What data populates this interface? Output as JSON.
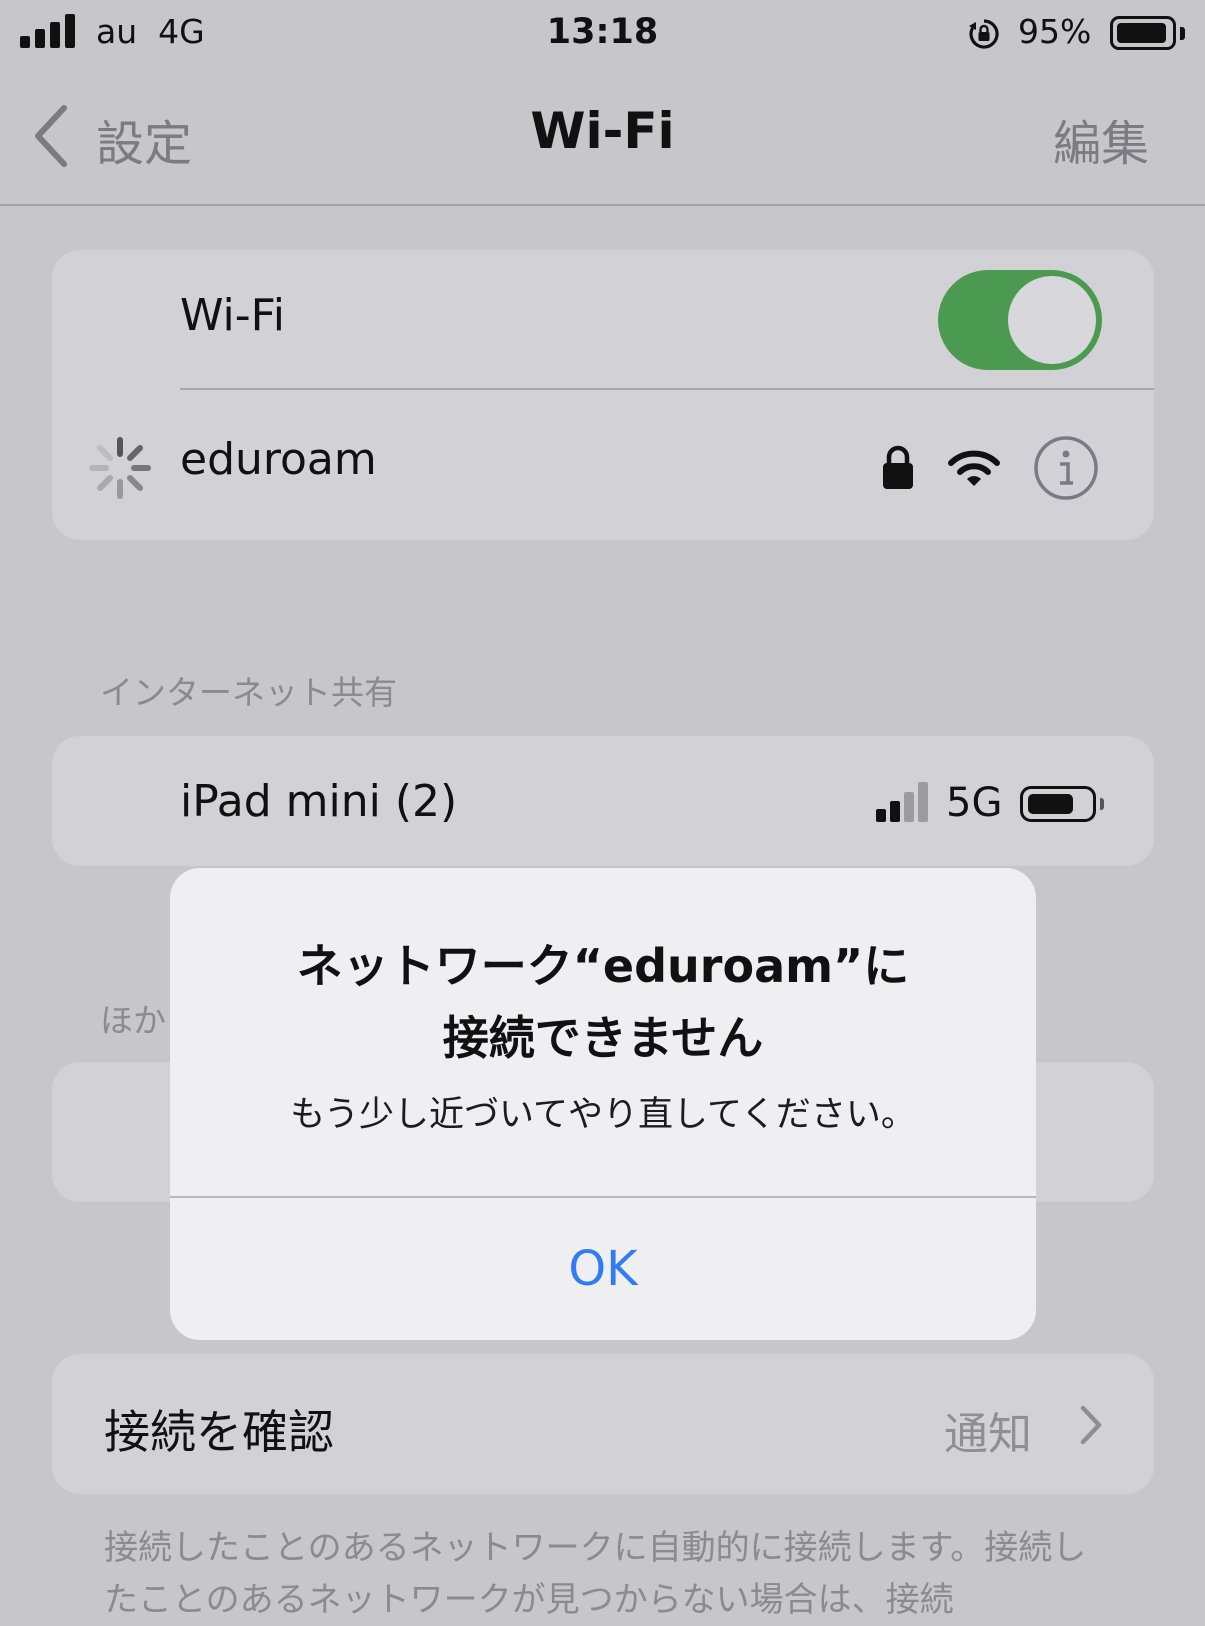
{
  "status_bar": {
    "carrier": "au  4G",
    "time": "13:18",
    "battery_pct": "95%",
    "battery_level": 0.95,
    "icons": [
      "cellular-signal-icon",
      "orientation-lock-icon",
      "battery-icon"
    ]
  },
  "nav": {
    "back_label": "設定",
    "title": "Wi-Fi",
    "edit_label": "編集"
  },
  "wifi_section": {
    "toggle_label": "Wi-Fi",
    "toggle_on": true,
    "network": {
      "name": "eduroam",
      "icons": [
        "loading-spinner-icon",
        "lock-icon",
        "wifi-signal-icon",
        "info-icon"
      ]
    }
  },
  "hotspot_section": {
    "header": "インターネット共有",
    "device": {
      "name": "iPad mini (2)",
      "network_type": "5G",
      "signal_bars": 2,
      "signal_bars_total": 4,
      "battery_level": 0.75
    }
  },
  "other_section": {
    "header_visible": "ほか"
  },
  "confirm_section": {
    "label": "接続を確認",
    "value": "通知",
    "footer": "接続したことのあるネットワークに自動的に接続します。接続したことのあるネットワークが見つからない場合は、接続"
  },
  "alert": {
    "title_line1": "ネットワーク“eduroam”に",
    "title_line2": "接続できません",
    "message": "もう少し近づいてやり直してください。",
    "ok_label": "OK"
  },
  "colors": {
    "toggle_green": "#4c9a51",
    "alert_button_blue": "#2f7cf6",
    "dimmed_background": "#c6c6cb"
  }
}
